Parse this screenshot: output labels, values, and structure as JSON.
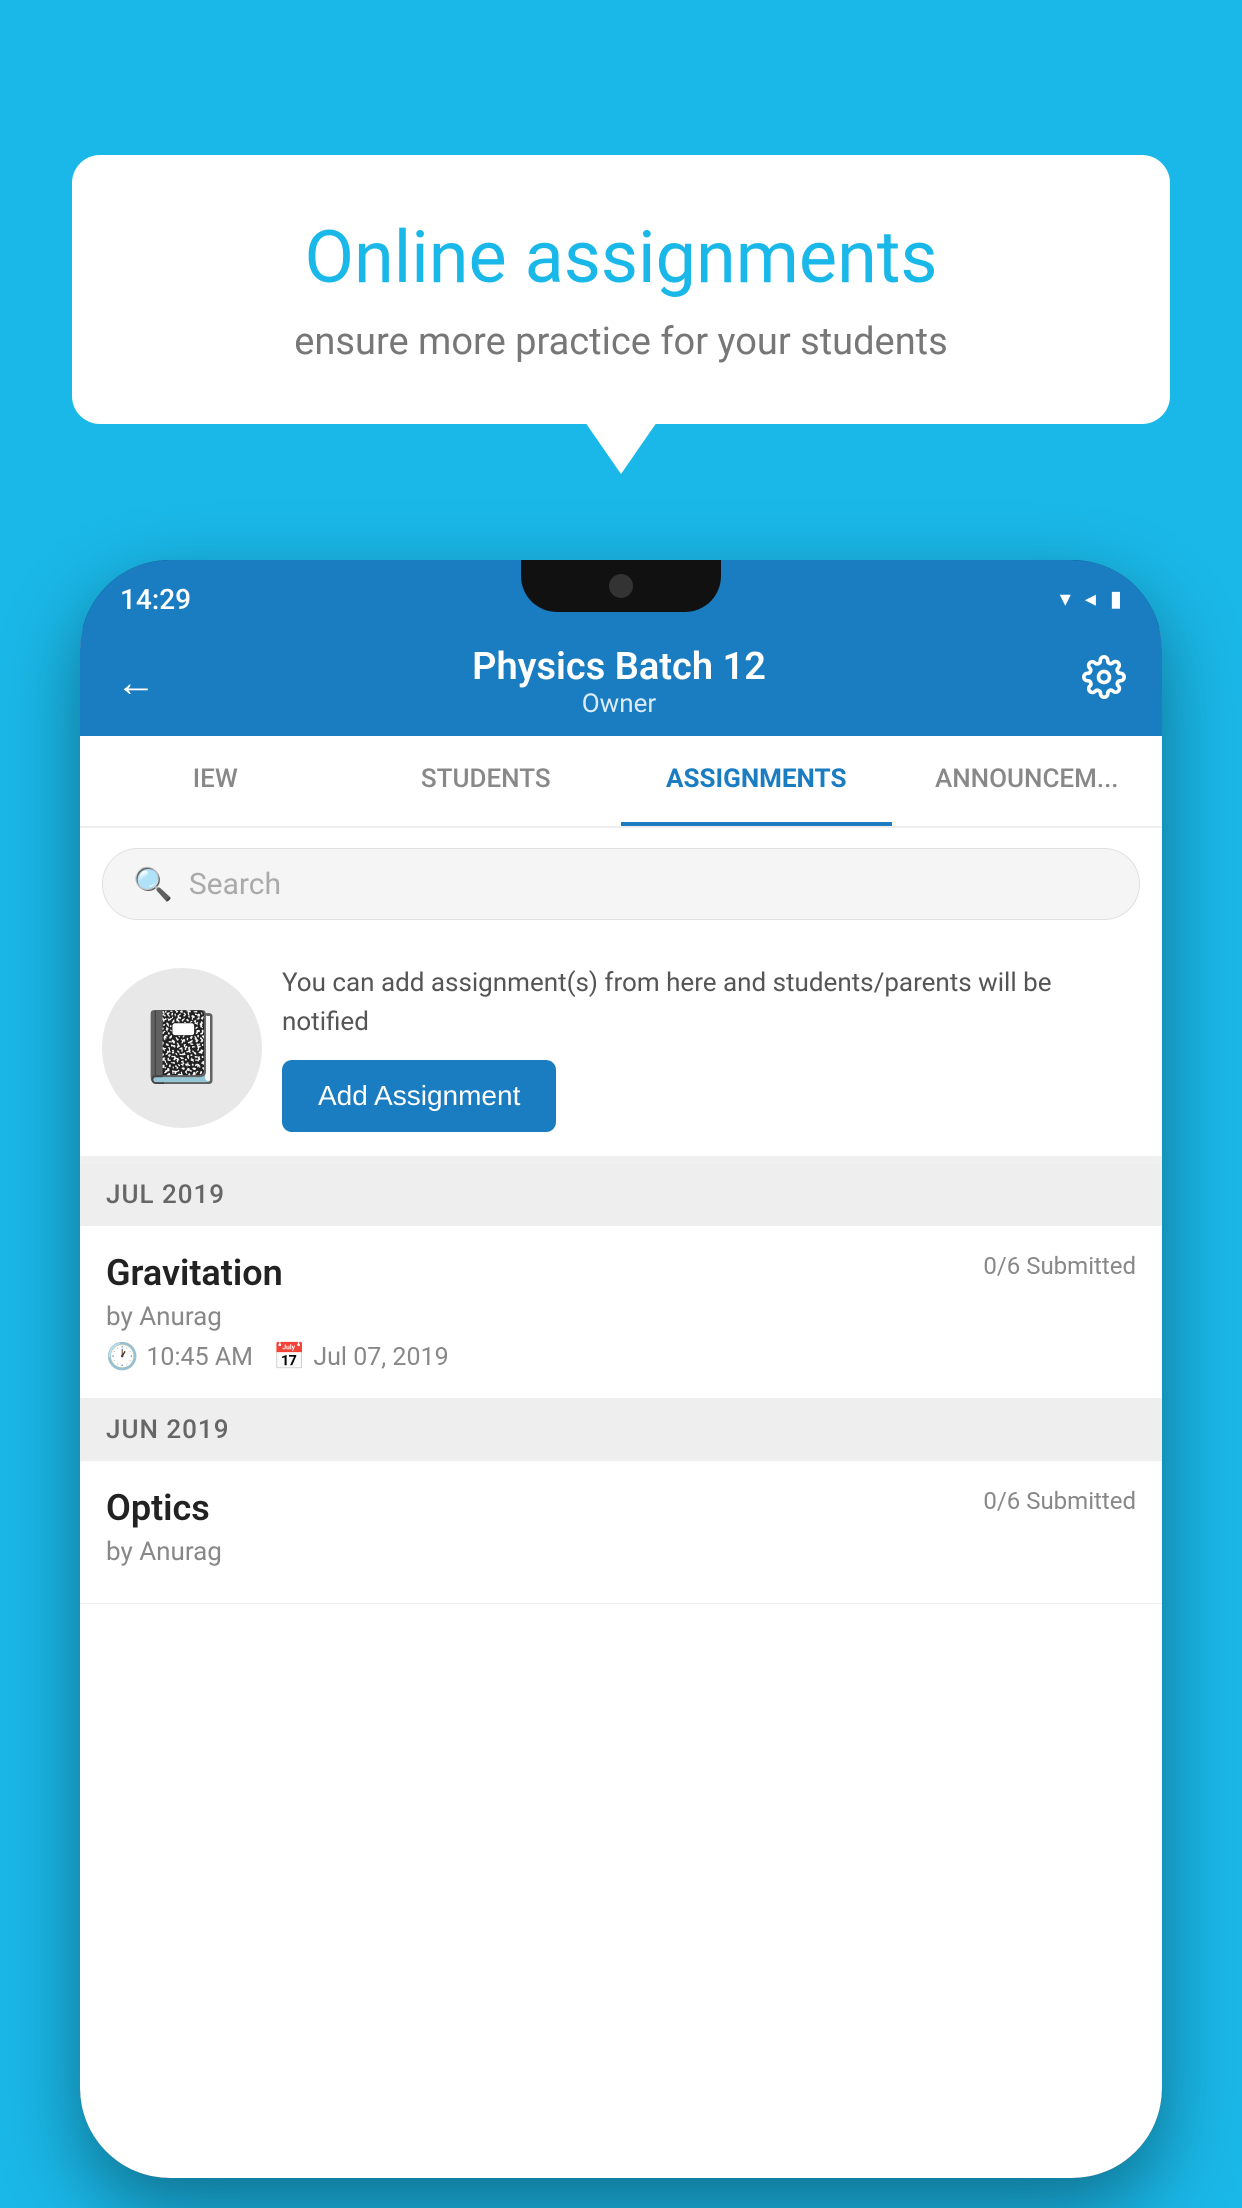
{
  "background_color": "#1ab8e8",
  "speech_bubble": {
    "title": "Online assignments",
    "subtitle": "ensure more practice for your students"
  },
  "status_bar": {
    "time": "14:29",
    "wifi_icon": "▼",
    "signal_icon": "▲",
    "battery_icon": "▌"
  },
  "header": {
    "title": "Physics Batch 12",
    "subtitle": "Owner",
    "back_label": "←",
    "settings_label": "⚙"
  },
  "tabs": [
    {
      "label": "IEW",
      "active": false
    },
    {
      "label": "STUDENTS",
      "active": false
    },
    {
      "label": "ASSIGNMENTS",
      "active": true
    },
    {
      "label": "ANNOUNCEM...",
      "active": false
    }
  ],
  "search": {
    "placeholder": "Search"
  },
  "promo": {
    "description": "You can add assignment(s) from here and students/parents will be notified",
    "button_label": "Add Assignment"
  },
  "sections": [
    {
      "month": "JUL 2019",
      "assignments": [
        {
          "title": "Gravitation",
          "submitted": "0/6 Submitted",
          "by": "by Anurag",
          "time": "10:45 AM",
          "date": "Jul 07, 2019"
        }
      ]
    },
    {
      "month": "JUN 2019",
      "assignments": [
        {
          "title": "Optics",
          "submitted": "0/6 Submitted",
          "by": "by Anurag",
          "time": "",
          "date": ""
        }
      ]
    }
  ]
}
